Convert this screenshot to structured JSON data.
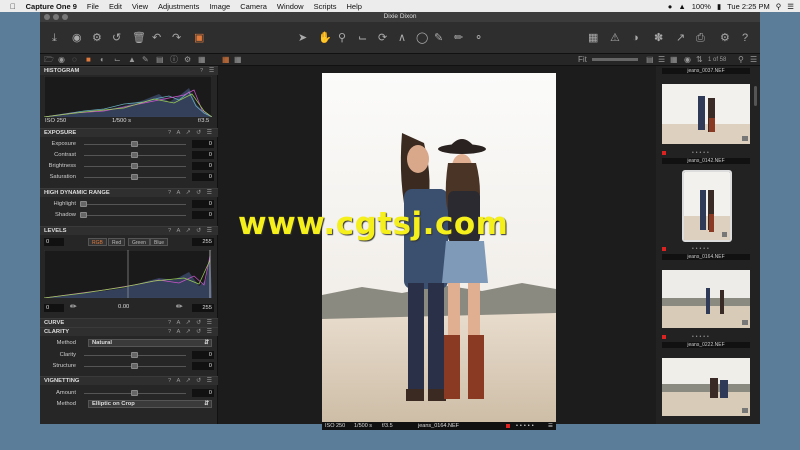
{
  "menubar": {
    "app": "Capture One 9",
    "items": [
      "File",
      "Edit",
      "View",
      "Adjustments",
      "Image",
      "Camera",
      "Window",
      "Scripts",
      "Help"
    ],
    "battery": "100%",
    "time": "Tue 2:25 PM"
  },
  "window": {
    "title": "Dixie Dixon"
  },
  "browser_header": {
    "count": "1 of 58"
  },
  "histogram": {
    "title": "HISTOGRAM",
    "iso": "ISO 250",
    "shutter": "1/500 s",
    "aperture": "f/3.5"
  },
  "exposure": {
    "title": "EXPOSURE",
    "rows": [
      {
        "label": "Exposure",
        "value": "0",
        "pos": 0.5
      },
      {
        "label": "Contrast",
        "value": "0",
        "pos": 0.5
      },
      {
        "label": "Brightness",
        "value": "0",
        "pos": 0.5
      },
      {
        "label": "Saturation",
        "value": "0",
        "pos": 0.5
      }
    ]
  },
  "hdr": {
    "title": "HIGH DYNAMIC RANGE",
    "rows": [
      {
        "label": "Highlight",
        "value": "0",
        "pos": 0
      },
      {
        "label": "Shadow",
        "value": "0",
        "pos": 0
      }
    ]
  },
  "levels": {
    "title": "LEVELS",
    "low": "0",
    "high": "255",
    "channels": [
      "RGB",
      "Red",
      "Green",
      "Blue"
    ],
    "out_low": "0",
    "mid": "0.00",
    "out_high": "255"
  },
  "curve": {
    "title": "CURVE"
  },
  "clarity": {
    "title": "CLARITY",
    "method_label": "Method",
    "method_value": "Natural",
    "rows": [
      {
        "label": "Clarity",
        "value": "0",
        "pos": 0.5
      },
      {
        "label": "Structure",
        "value": "0",
        "pos": 0.5
      }
    ]
  },
  "vignetting": {
    "title": "VIGNETTING",
    "amount_label": "Amount",
    "amount_value": "0",
    "amount_pos": 0.5,
    "method_label": "Method",
    "method_value": "Elliptic on Crop"
  },
  "viewer": {
    "iso": "ISO 250",
    "shutter": "1/500 s",
    "aperture": "f/3.5",
    "file": "jeans_0164.NEF"
  },
  "browser": {
    "top_file": "jeans_0037.NEF",
    "thumbs": [
      {
        "file": "jeans_0142.NEF"
      },
      {
        "file": "jeans_0164.NEF"
      },
      {
        "file": "jeans_0222.NEF"
      },
      {
        "file": ""
      }
    ]
  },
  "watermark": "www.cgtsj.com",
  "colors": {
    "accent": "#e07a3c",
    "watermark": "#f5ef1c",
    "desktop": "#5b7d99"
  }
}
